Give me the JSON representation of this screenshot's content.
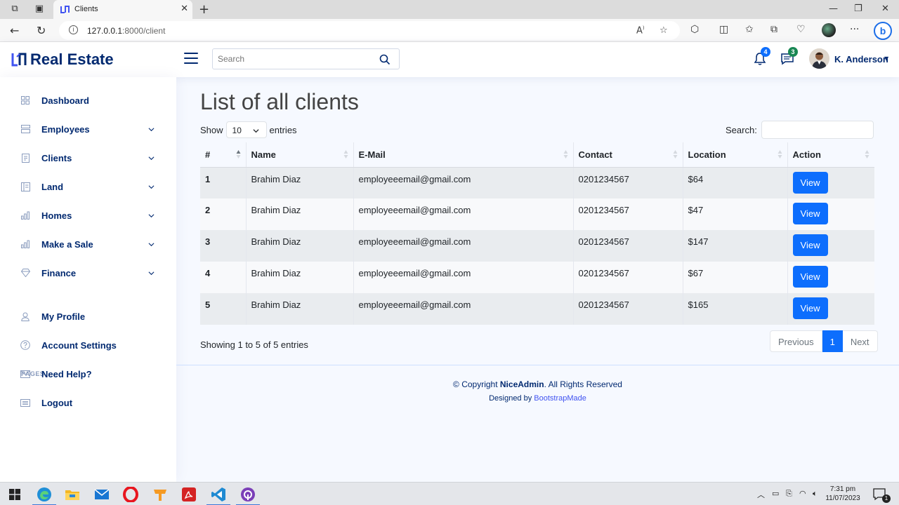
{
  "browser": {
    "tab_title": "Clients",
    "url_host": "127.0.0.1",
    "url_path": ":8000/client"
  },
  "header": {
    "brand": "Real Estate",
    "search_placeholder": "Search",
    "notifications_count": "4",
    "messages_count": "3",
    "user_name": "K. Anderson"
  },
  "sidebar": {
    "items": [
      {
        "label": "Dashboard",
        "icon": "grid-icon"
      },
      {
        "label": "Employees",
        "icon": "menu-button-icon"
      },
      {
        "label": "Clients",
        "icon": "journal-text-icon"
      },
      {
        "label": "Land",
        "icon": "layout-text-icon"
      },
      {
        "label": "Homes",
        "icon": "bar-chart-icon"
      },
      {
        "label": "Make a Sale",
        "icon": "bar-chart-icon"
      },
      {
        "label": "Finance",
        "icon": "gem-icon"
      }
    ],
    "pages_heading": "PAGES",
    "pages": [
      {
        "label": "My Profile",
        "icon": "person-icon"
      },
      {
        "label": "Account Settings",
        "icon": "question-circle-icon"
      },
      {
        "label": "Need Help?",
        "icon": "envelope-icon"
      },
      {
        "label": "Logout",
        "icon": "card-list-icon"
      }
    ]
  },
  "main": {
    "title": "List of all clients",
    "show_label": "Show",
    "entries_label": "entries",
    "page_length": "10",
    "search_label": "Search:",
    "columns": [
      "#",
      "Name",
      "E-Mail",
      "Contact",
      "Location",
      "Action"
    ],
    "rows": [
      {
        "num": "1",
        "name": "Brahim Diaz",
        "email": "employeeemail@gmail.com",
        "contact": "0201234567",
        "location": "$64",
        "action": "View"
      },
      {
        "num": "2",
        "name": "Brahim Diaz",
        "email": "employeeemail@gmail.com",
        "contact": "0201234567",
        "location": "$47",
        "action": "View"
      },
      {
        "num": "3",
        "name": "Brahim Diaz",
        "email": "employeeemail@gmail.com",
        "contact": "0201234567",
        "location": "$147",
        "action": "View"
      },
      {
        "num": "4",
        "name": "Brahim Diaz",
        "email": "employeeemail@gmail.com",
        "contact": "0201234567",
        "location": "$67",
        "action": "View"
      },
      {
        "num": "5",
        "name": "Brahim Diaz",
        "email": "employeeemail@gmail.com",
        "contact": "0201234567",
        "location": "$165",
        "action": "View"
      }
    ],
    "info": "Showing 1 to 5 of 5 entries",
    "pagination": {
      "previous": "Previous",
      "current": "1",
      "next": "Next"
    }
  },
  "footer": {
    "copyright_prefix": "© Copyright ",
    "copyright_brand": "NiceAdmin",
    "copyright_suffix": ". All Rights Reserved",
    "designed_by": "Designed by ",
    "designer": "BootstrapMade"
  },
  "taskbar": {
    "time": "7:31 pm",
    "date": "11/07/2023",
    "notification_count": "1"
  },
  "colors": {
    "brand_navy": "#012970",
    "primary": "#0d6efd",
    "page_bg": "#f6f9ff",
    "notif_badge": "#0d6efd",
    "msg_badge": "#198754"
  }
}
